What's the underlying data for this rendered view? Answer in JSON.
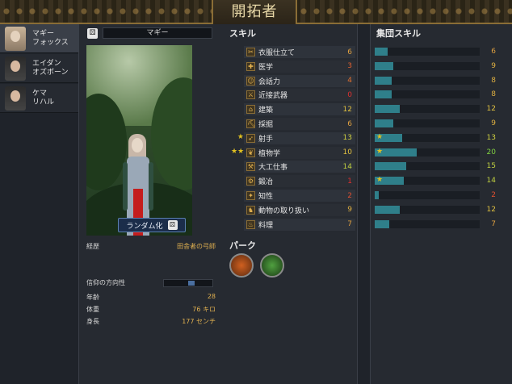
{
  "header": {
    "title": "開拓者"
  },
  "characters": [
    {
      "name_line1": "マギー",
      "name_line2": "フォックス",
      "active": true
    },
    {
      "name_line1": "エイダン",
      "name_line2": "オズボーン",
      "active": false
    },
    {
      "name_line1": "ケマ",
      "name_line2": "リハル",
      "active": false
    }
  ],
  "character": {
    "name": "マギー",
    "randomize_label": "ランダム化",
    "background_label": "経歴",
    "background_value": "田舎者の弓師",
    "faith_label": "信仰の方向性",
    "faith_level": 0.55,
    "age_label": "年齢",
    "age_value": "28",
    "weight_label": "体重",
    "weight_value": "76 キロ",
    "height_label": "身長",
    "height_value": "177 センチ"
  },
  "skills_title": "スキル",
  "skills": [
    {
      "name": "衣服仕立て",
      "value": "6",
      "stars": "",
      "color": "#e0a040"
    },
    {
      "name": "医学",
      "value": "3",
      "stars": "",
      "color": "#e06030"
    },
    {
      "name": "会話力",
      "value": "4",
      "stars": "",
      "color": "#e07030"
    },
    {
      "name": "近接武器",
      "value": "0",
      "stars": "",
      "color": "#e03030"
    },
    {
      "name": "建築",
      "value": "12",
      "stars": "",
      "color": "#e0c040"
    },
    {
      "name": "採掘",
      "value": "6",
      "stars": "",
      "color": "#e0a040"
    },
    {
      "name": "射手",
      "value": "13",
      "stars": "★",
      "color": "#d0d040"
    },
    {
      "name": "植物学",
      "value": "10",
      "stars": "★★",
      "color": "#e0c040"
    },
    {
      "name": "大工仕事",
      "value": "14",
      "stars": "",
      "color": "#c0d040"
    },
    {
      "name": "鍛冶",
      "value": "1",
      "stars": "",
      "color": "#e03030"
    },
    {
      "name": "知性",
      "value": "2",
      "stars": "",
      "color": "#e05030"
    },
    {
      "name": "動物の取り扱い",
      "value": "9",
      "stars": "",
      "color": "#e0b040"
    },
    {
      "name": "料理",
      "value": "7",
      "stars": "",
      "color": "#e0a040"
    }
  ],
  "perks_title": "パーク",
  "group_title": "集団スキル",
  "group_skills": [
    {
      "value": "6",
      "level": 0.12,
      "star": false,
      "color": "#e0a040"
    },
    {
      "value": "9",
      "level": 0.18,
      "star": false,
      "color": "#e0b040"
    },
    {
      "value": "8",
      "level": 0.16,
      "star": false,
      "color": "#e0b040"
    },
    {
      "value": "8",
      "level": 0.16,
      "star": false,
      "color": "#e0b040"
    },
    {
      "value": "12",
      "level": 0.24,
      "star": false,
      "color": "#e0c040"
    },
    {
      "value": "9",
      "level": 0.18,
      "star": false,
      "color": "#e0b040"
    },
    {
      "value": "13",
      "level": 0.26,
      "star": true,
      "color": "#d0d040"
    },
    {
      "value": "20",
      "level": 0.4,
      "star": true,
      "color": "#80d040"
    },
    {
      "value": "15",
      "level": 0.3,
      "star": false,
      "color": "#c0d040"
    },
    {
      "value": "14",
      "level": 0.28,
      "star": true,
      "color": "#c0d040"
    },
    {
      "value": "2",
      "level": 0.04,
      "star": false,
      "color": "#e05030"
    },
    {
      "value": "12",
      "level": 0.24,
      "star": false,
      "color": "#e0c040"
    },
    {
      "value": "7",
      "level": 0.14,
      "star": false,
      "color": "#e0a040"
    }
  ]
}
